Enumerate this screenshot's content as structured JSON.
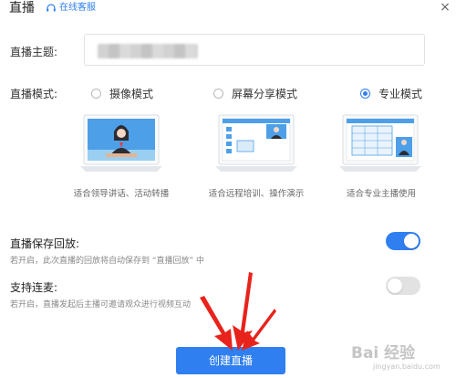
{
  "window": {
    "title": "直播",
    "service_label": "在线客服",
    "close_glyph": "×"
  },
  "form": {
    "topic_label": "直播主题:",
    "topic_value": "",
    "mode_label": "直播模式:"
  },
  "modes": [
    {
      "label": "摄像模式",
      "caption": "适合领导讲话、活动转播",
      "selected": false
    },
    {
      "label": "屏幕分享模式",
      "caption": "适合远程培训、操作演示",
      "selected": false
    },
    {
      "label": "专业模式",
      "caption": "适合专业主播使用",
      "selected": true
    }
  ],
  "settings": {
    "save_replay": {
      "title": "直播保存回放:",
      "desc": "若开启，此次直播的回放将自动保存到 “直播回放” 中",
      "enabled": true
    },
    "co_host": {
      "title": "支持连麦:",
      "desc": "若开启，直播发起后主播可邀请观众进行视频互动",
      "enabled": false
    }
  },
  "actions": {
    "create_label": "创建直播"
  },
  "watermark": {
    "main": "Bai 经验",
    "sub": "jingyan.baidu.com"
  },
  "colors": {
    "accent": "#2f7ff0",
    "arrow": "#e8231c"
  }
}
